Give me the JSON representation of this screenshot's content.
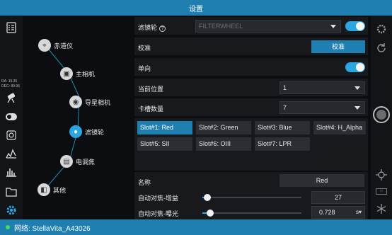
{
  "window": {
    "title": "设置"
  },
  "status": {
    "network_label": "网络: StellaVita_A43026",
    "indicator_color": "#43e05a"
  },
  "coords": {
    "ra": "RA: 15.35",
    "dec": "DEC: 89.96"
  },
  "left_sidebar": {
    "icons": [
      "checklist-icon",
      "telescope-icon",
      "filter-wheel-icon",
      "focus-icon",
      "settings-target-icon",
      "histogram-icon",
      "bar-chart-icon",
      "folder-icon",
      "gear-icon"
    ],
    "active": "gear-icon"
  },
  "device_tree": {
    "nodes": [
      {
        "label": "赤道仪",
        "icon": "mount-icon"
      },
      {
        "label": "主相机",
        "icon": "camera-icon"
      },
      {
        "label": "导星相机",
        "icon": "guide-camera-icon"
      },
      {
        "label": "滤镜轮",
        "icon": "filter-wheel-icon",
        "active": true
      },
      {
        "label": "电调焦",
        "icon": "focuser-icon"
      },
      {
        "label": "其他",
        "icon": "other-icon"
      }
    ]
  },
  "settings": {
    "filter_wheel": {
      "label": "滤镜轮",
      "help": "?",
      "value": "FILTERWHEEL",
      "enabled": true
    },
    "calibrate": {
      "label": "校准",
      "button": "校准"
    },
    "unidirectional": {
      "label": "单向",
      "enabled": true
    },
    "current_position": {
      "label": "当前位置",
      "value": "1"
    },
    "slot_count": {
      "label": "卡槽数量",
      "value": "7"
    },
    "slots": [
      "Slot#1: Red",
      "Slot#2: Green",
      "Slot#3: Blue",
      "Slot#4: H_Alpha",
      "Slot#5: SII",
      "Slot#6: OIII",
      "Slot#7: LPR"
    ],
    "active_slot": 0,
    "name": {
      "label": "名称",
      "value": "Red"
    },
    "af_gain": {
      "label": "自动对焦-增益",
      "value": "27",
      "fraction": 0.05
    },
    "af_exposure": {
      "label": "自动对焦-曝光",
      "value": "0.728",
      "unit": "s",
      "fraction": 0.08
    }
  },
  "right_sidebar": {
    "icons": [
      "settings-dial-icon",
      "refresh-icon",
      "shutter-button",
      "crosshair-icon",
      "frame-icon",
      "snowflake-icon"
    ]
  },
  "accent_color": "#2aa6e0"
}
